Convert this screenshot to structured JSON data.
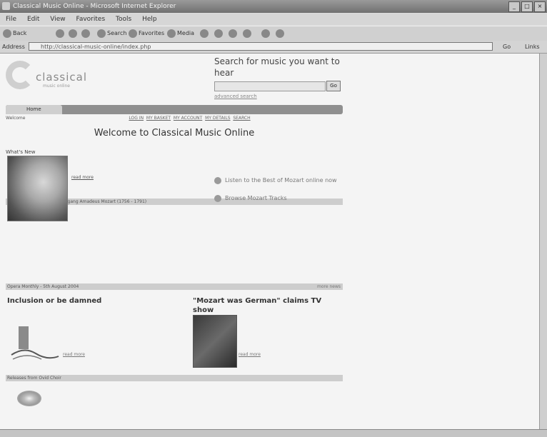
{
  "window": {
    "title": "Classical Music Online - Microsoft Internet Explorer",
    "minimize": "_",
    "maximize": "□",
    "close": "×"
  },
  "menu": [
    "File",
    "Edit",
    "View",
    "Favorites",
    "Tools",
    "Help"
  ],
  "toolbar": {
    "back": "Back",
    "search": "Search",
    "favorites": "Favorites",
    "media": "Media"
  },
  "address": {
    "label": "Address",
    "url": "http://classical-music-online/index.php",
    "go": "Go",
    "links": "Links"
  },
  "site": {
    "logo_word": "classical",
    "logo_tag": "music online",
    "search_heading": "Search for music you want to hear",
    "search_button": "Go",
    "advanced": "advanced search",
    "nav": [
      "Home",
      "",
      "",
      "",
      "",
      ""
    ],
    "welcome_prefix": "Welcome",
    "welcome_links": [
      "LOG IN",
      "MY BASKET",
      "MY ACCOUNT",
      "MY DETAILS",
      "SEARCH"
    ],
    "page_title": "Welcome to Classical Music Online",
    "whats_new": "What's New",
    "composer_bar": "Composer of the week: Wolfgang Amadeus Mozart (1756 - 1791)",
    "bio_more": "read more",
    "mozart_links": [
      "Listen to the Best of Mozart online now",
      "Browse Mozart Tracks"
    ],
    "news_bar": "Opera Monthly - 5th August 2004",
    "news_bar_right": "more news",
    "article1_title": "Inclusion or be damned",
    "article2_title": "\"Mozart was German\" claims TV show",
    "article_more": "read more",
    "releases_bar": "Releases from Ovid Choir"
  }
}
